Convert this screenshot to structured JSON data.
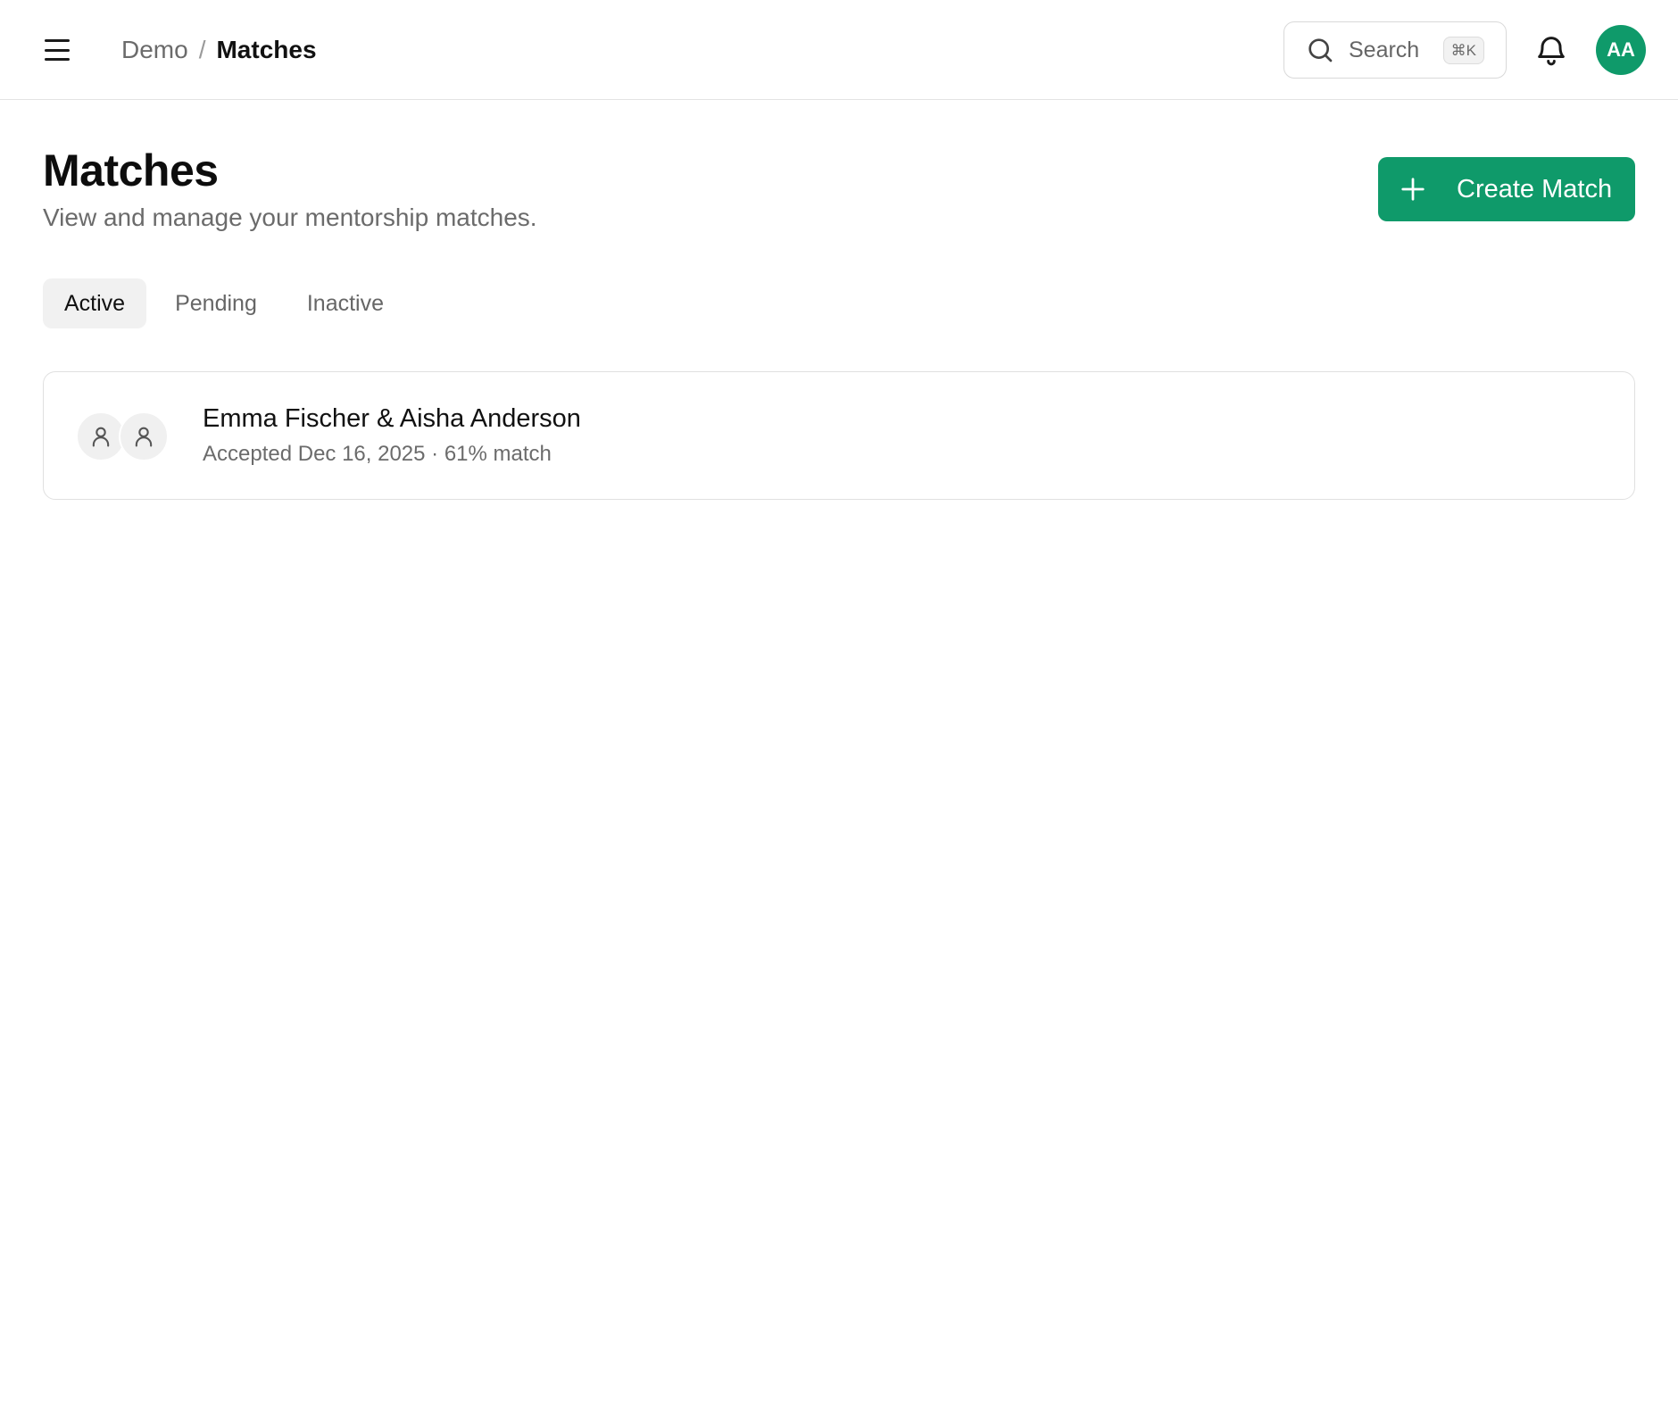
{
  "header": {
    "breadcrumb_root": "Demo",
    "breadcrumb_separator": "/",
    "breadcrumb_current": "Matches",
    "search_label": "Search",
    "search_shortcut": "⌘K",
    "user_initials": "AA"
  },
  "page": {
    "title": "Matches",
    "subtitle": "View and manage your mentorship matches.",
    "create_label": "Create Match"
  },
  "tabs": [
    {
      "label": "Active",
      "active": true
    },
    {
      "label": "Pending",
      "active": false
    },
    {
      "label": "Inactive",
      "active": false
    }
  ],
  "matches": [
    {
      "names": "Emma Fischer & Aisha Anderson",
      "meta": "Accepted Dec 16, 2025 · 61% match"
    }
  ],
  "icons": {
    "menu": "menu-icon",
    "search": "search-icon",
    "notifications": "bell-icon",
    "create": "plus-icon",
    "person": "user-icon"
  },
  "colors": {
    "accent": "#0f9a6a",
    "muted_text": "#6b6b6b",
    "border": "#e0e0e0",
    "active_tab_bg": "#f1f1f1"
  }
}
